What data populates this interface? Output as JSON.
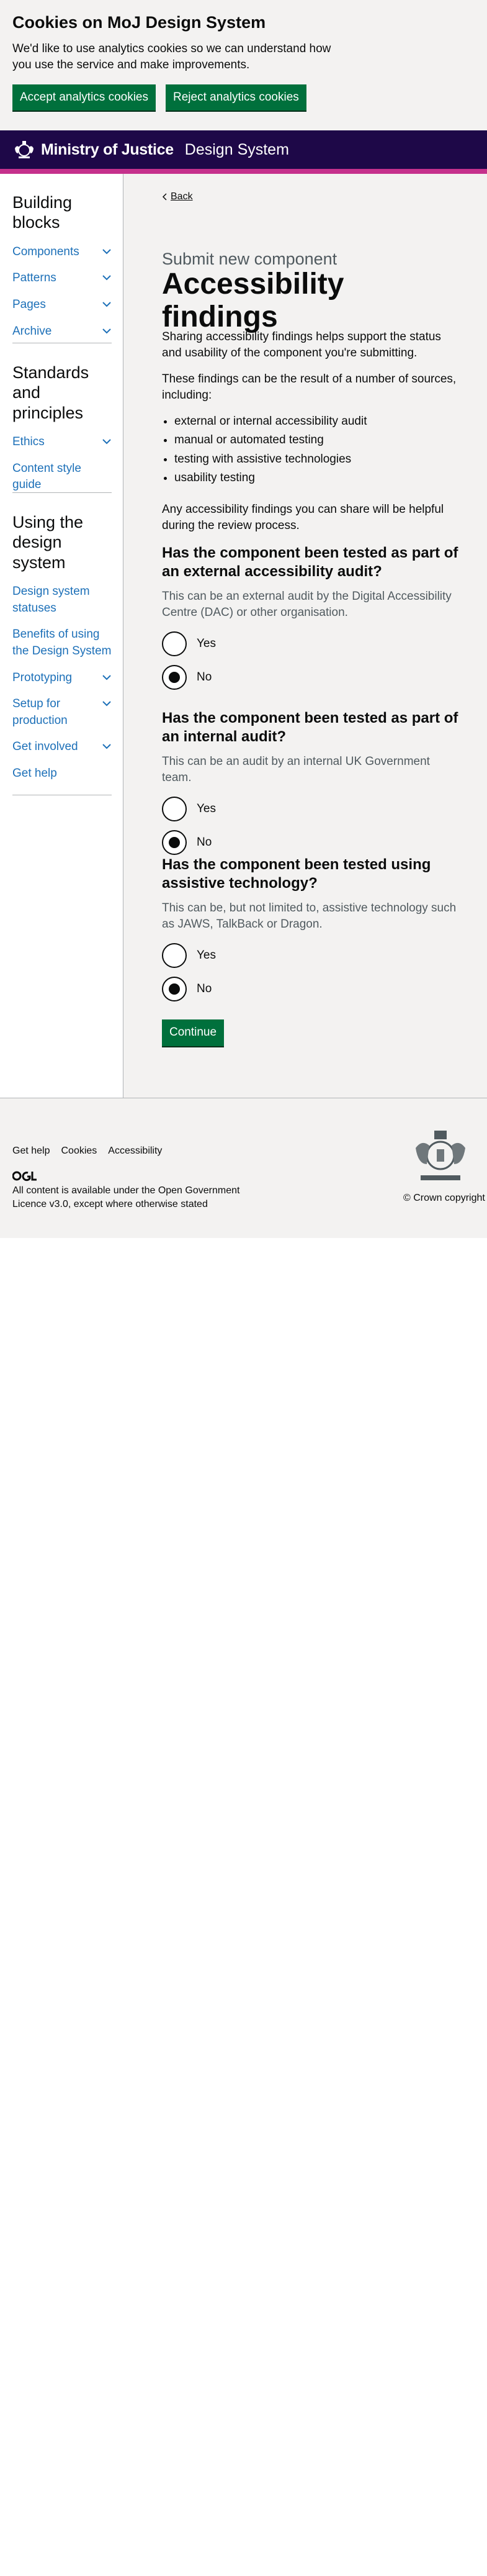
{
  "cookie_banner": {
    "title": "Cookies on MoJ Design System",
    "text": "We'd like to use analytics cookies so we can understand how you use the service and make improvements.",
    "accept_label": "Accept analytics cookies",
    "reject_label": "Reject analytics cookies"
  },
  "header": {
    "brand": "Ministry of Justice",
    "product": "Design System"
  },
  "sidebar": {
    "sections": [
      {
        "heading": "Building blocks",
        "items": [
          {
            "label": "Components"
          },
          {
            "label": "Patterns"
          },
          {
            "label": "Pages"
          },
          {
            "label": "Archive"
          }
        ]
      },
      {
        "heading": "Standards and principles",
        "items": [
          {
            "label": "Ethics"
          },
          {
            "label": "Content style guide"
          }
        ]
      },
      {
        "heading": "Using the design system",
        "items": [
          {
            "label": "Design system statuses"
          },
          {
            "label": "Benefits of using the Design System"
          },
          {
            "label": "Prototyping"
          },
          {
            "label": "Setup for production"
          },
          {
            "label": "Get involved"
          },
          {
            "label": "Get help"
          }
        ]
      }
    ]
  },
  "main": {
    "back_label": "Back",
    "caption": "Submit new component",
    "title": "Accessibility findings",
    "intro_1": "Sharing accessibility findings helps support the status and usability of the component you're submitting.",
    "intro_2": "These findings can be the result of a number of sources, including:",
    "sources": [
      "external or internal accessibility audit",
      "manual or automated testing",
      "testing with assistive technologies",
      "usability testing"
    ],
    "intro_3": "Any accessibility findings you can share will be helpful during the review process.",
    "questions": [
      {
        "title": "Has the component been tested as part of an external accessibility audit?",
        "hint": "This can be an external audit by the Digital Accessibility Centre (DAC) or other organisation.",
        "yes": "Yes",
        "no": "No"
      },
      {
        "title": "Has the component been tested as part of an internal audit?",
        "hint": "This can be an audit by an internal UK Government team.",
        "yes": "Yes",
        "no": "No"
      },
      {
        "title": "Has the component been tested using assistive technology?",
        "hint": "This can be, but not limited to, assistive technology such as JAWS, TalkBack or Dragon.",
        "yes": "Yes",
        "no": "No"
      }
    ],
    "continue_label": "Continue"
  },
  "footer": {
    "links": [
      "Get help",
      "Cookies",
      "Accessibility"
    ],
    "licence_prefix": "All content is available under the ",
    "licence_link": "Open Government Licence v3.0",
    "licence_suffix": ", except where otherwise stated",
    "copyright": "© Crown copyright"
  },
  "colors": {
    "header_bg": "#1e0848",
    "header_stripe": "#c5318c",
    "button_green": "#00703c",
    "link_blue": "#1d70b8",
    "panel_grey": "#f3f2f1"
  }
}
